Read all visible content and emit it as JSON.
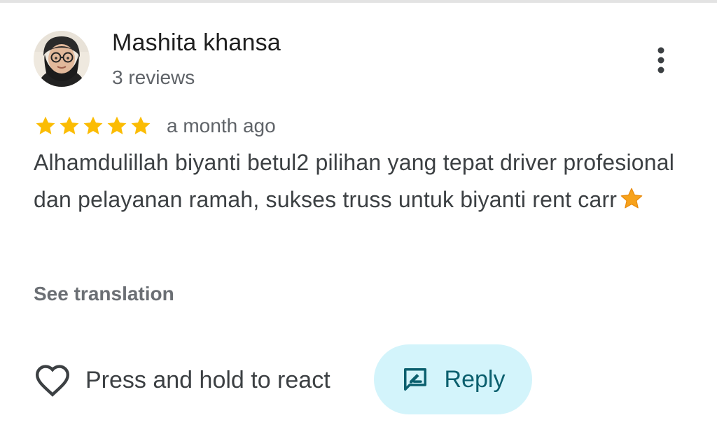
{
  "review": {
    "author": {
      "name": "Mashita khansa",
      "review_count": "3 reviews",
      "avatar_icon": "user-avatar-photo"
    },
    "rating": 5,
    "max_rating": 5,
    "time": "a month ago",
    "text": "Alhamdulillah biyanti betul2 pilihan yang tepat driver profesional dan pelayanan ramah, sukses truss untuk biyanti rent carr",
    "text_emoji": "star-emoji-icon",
    "see_translation": "See translation"
  },
  "actions": {
    "react_label": "Press and hold to react",
    "react_icon": "heart-outline-icon",
    "reply_label": "Reply",
    "reply_icon": "rate-review-icon",
    "more_icon": "more-vert-icon"
  },
  "colors": {
    "star": "#fbbc04",
    "reply_bg": "#d3f4fb",
    "reply_text": "#0b5f6e",
    "secondary_text": "#5f6368"
  }
}
